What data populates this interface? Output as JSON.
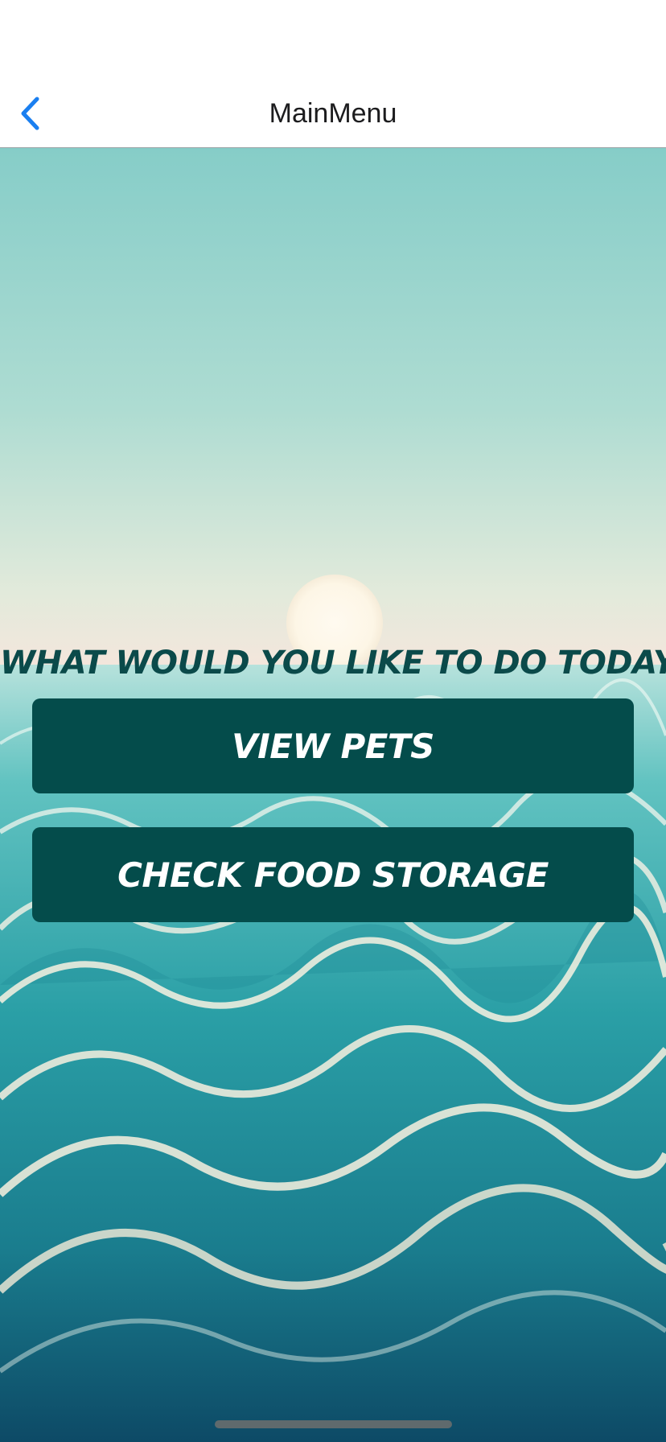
{
  "nav": {
    "title": "MainMenu",
    "back_icon": "chevron-left-icon",
    "back_color": "#1a7ff0"
  },
  "main": {
    "prompt": "WHAT WOULD YOU LIKE TO DO TODAY?",
    "buttons": [
      {
        "label": "VIEW PETS"
      },
      {
        "label": "CHECK FOOD STORAGE"
      }
    ]
  },
  "colors": {
    "button_bg": "#044c4b",
    "prompt_text": "#0b4a4a",
    "button_text": "#ffffff"
  }
}
